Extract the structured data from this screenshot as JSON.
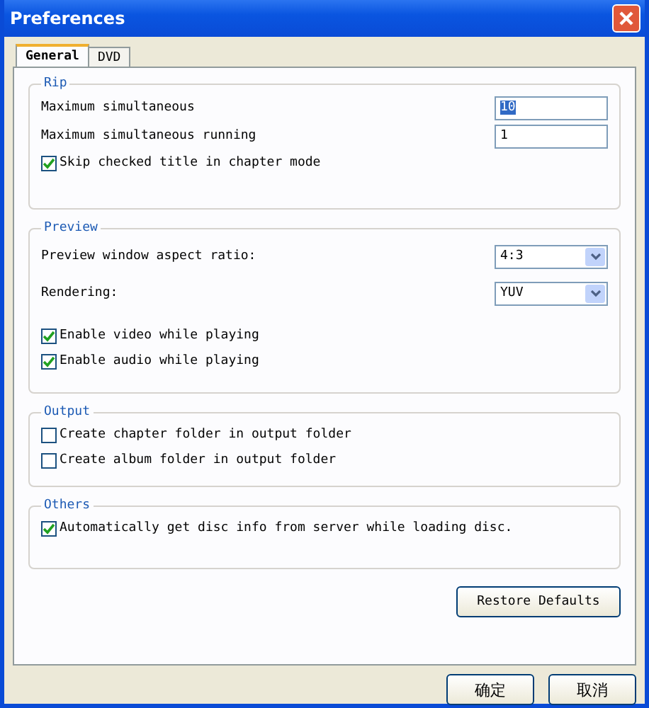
{
  "window": {
    "title": "Preferences"
  },
  "tabs": [
    {
      "label": "General",
      "selected": true
    },
    {
      "label": "DVD",
      "selected": false
    }
  ],
  "groups": [
    {
      "title": "Rip",
      "items": [
        {
          "kind": "text_field",
          "label": "Maximum simultaneous",
          "value": "10",
          "highlighted": true
        },
        {
          "kind": "text_field",
          "label": "Maximum simultaneous running",
          "value": "1",
          "highlighted": false
        },
        {
          "kind": "checkbox",
          "label": "Skip checked title in chapter mode",
          "checked": true
        }
      ]
    },
    {
      "title": "Preview",
      "items": [
        {
          "kind": "dropdown",
          "label": "Preview window aspect ratio:",
          "value": "4:3"
        },
        {
          "kind": "dropdown",
          "label": "Rendering:",
          "value": "YUV"
        },
        {
          "kind": "checkbox",
          "label": "Enable video while playing",
          "checked": true
        },
        {
          "kind": "checkbox",
          "label": "Enable audio while playing",
          "checked": true
        }
      ]
    },
    {
      "title": "Output",
      "items": [
        {
          "kind": "checkbox",
          "label": "Create chapter folder in output folder",
          "checked": false
        },
        {
          "kind": "checkbox",
          "label": "Create album folder in output folder",
          "checked": false
        }
      ]
    },
    {
      "title": "Others",
      "items": [
        {
          "kind": "checkbox",
          "label": "Automatically get disc info from server while loading disc.",
          "checked": true
        }
      ]
    }
  ],
  "restore_button": "Restore Defaults",
  "buttons": [
    "确定",
    "取消"
  ]
}
